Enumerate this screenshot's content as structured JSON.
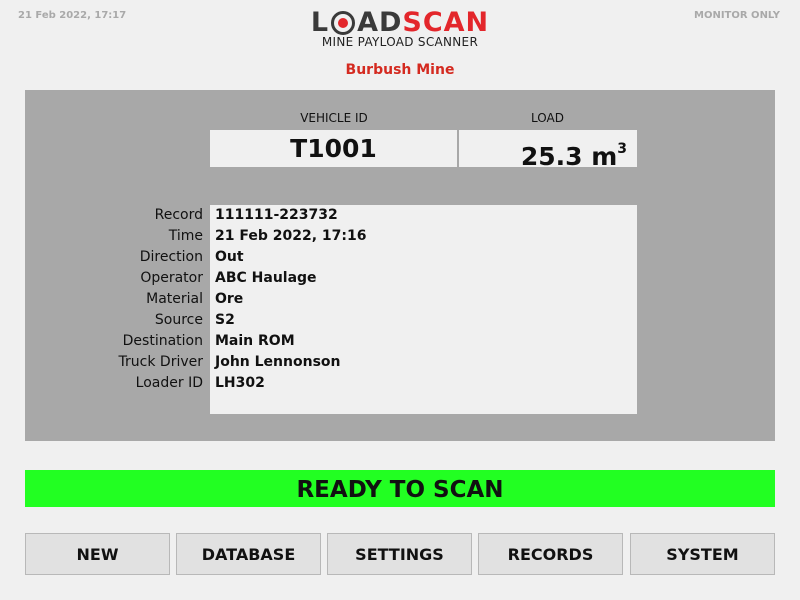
{
  "header": {
    "datetime": "21 Feb 2022, 17:17",
    "mode": "MONITOR ONLY",
    "logo": {
      "load_left": "L",
      "load_right": "AD",
      "scan": "SCAN"
    },
    "subtitle": "MINE PAYLOAD SCANNER",
    "site": "Burbush Mine"
  },
  "summary": {
    "vehicle_id_label": "VEHICLE ID",
    "vehicle_id": "T1001",
    "load_label": "LOAD",
    "load_value": "25.3 m",
    "load_unit_sup": "3"
  },
  "record": {
    "labels": [
      "Record",
      "Time",
      "Direction",
      "Operator",
      "Material",
      "Source",
      "Destination",
      "Truck Driver",
      "Loader ID"
    ],
    "values": [
      "111111-223732",
      "21 Feb 2022, 17:16",
      "Out",
      "ABC Haulage",
      "Ore",
      "S2",
      "Main ROM",
      "John Lennonson",
      "LH302"
    ]
  },
  "status": {
    "text": "READY TO SCAN",
    "color": "#22ff22"
  },
  "buttons": [
    "NEW",
    "DATABASE",
    "SETTINGS",
    "RECORDS",
    "SYSTEM"
  ],
  "colors": {
    "brand_red": "#e3262b",
    "brand_dark": "#3a3a3a",
    "site_red": "#d42a20",
    "panel_grey": "#a8a8a8"
  }
}
